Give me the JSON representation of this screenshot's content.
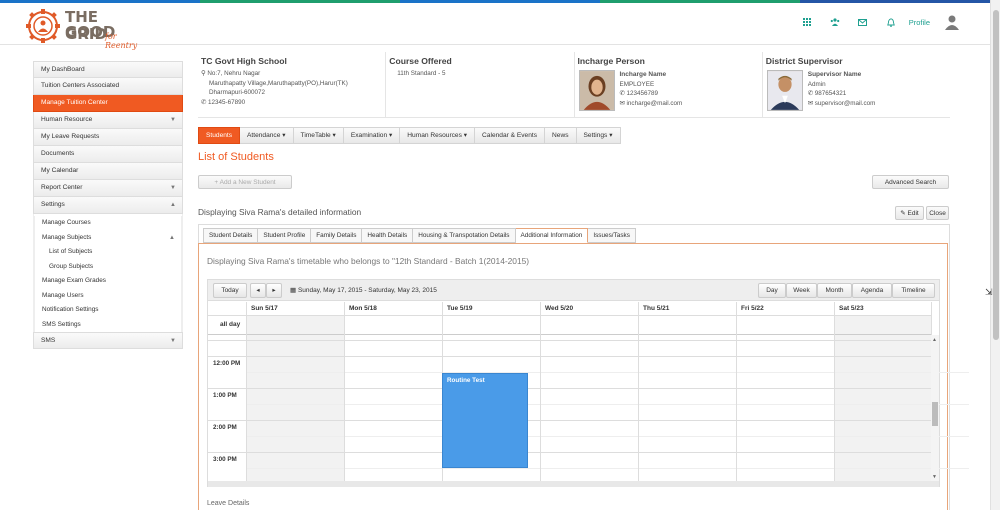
{
  "brand": {
    "line1": "THE GOOD",
    "line2": "GRID",
    "tagline": "for Reentry",
    "colors": {
      "accent": "#f05a22",
      "teal": "#1fa090"
    }
  },
  "header": {
    "icons": [
      "grid-icon",
      "users-icon",
      "mail-icon",
      "bell-icon"
    ],
    "profile_label": "Profile"
  },
  "sidebar": {
    "items": [
      {
        "label": "My DashBoard"
      },
      {
        "label": "Tuition Centers Associated"
      },
      {
        "label": "Manage Tuition Center",
        "active": true
      },
      {
        "label": "Human Resource",
        "caret": "▼"
      },
      {
        "label": "My Leave Requests"
      },
      {
        "label": "Documents"
      },
      {
        "label": "My Calendar"
      },
      {
        "label": "Report Center",
        "caret": "▼"
      },
      {
        "label": "Settings",
        "caret": "▲"
      }
    ],
    "settings_sub": [
      {
        "label": "Manage Courses"
      },
      {
        "label": "Manage Subjects",
        "caret": "▲"
      },
      {
        "label": "List of Subjects",
        "level": 2
      },
      {
        "label": "Group Subjects",
        "level": 2
      },
      {
        "label": "Manage Exam Grades"
      },
      {
        "label": "Manage Users"
      },
      {
        "label": "Notification Settings"
      },
      {
        "label": "SMS Settings"
      }
    ],
    "sms": {
      "label": "SMS",
      "caret": "▼"
    }
  },
  "school": {
    "title": "TC Govt High School",
    "address1": "No:7, Nehru Nagar",
    "address2": "Maruthapatty Village,Maruthapatty(PO),Harur(TK)",
    "address3": "Dharmapuri-600072",
    "phone": "12345-67890"
  },
  "course": {
    "title": "Course Offered",
    "value": "11th Standard - 5"
  },
  "incharge": {
    "title": "Incharge Person",
    "name": "Incharge Name",
    "role": "EMPLOYEE",
    "phone": "123456789",
    "email": "incharge@mail.com"
  },
  "supervisor": {
    "title": "District Supervisor",
    "name": "Supervisor Name",
    "role": "Admin",
    "phone": "987654321",
    "email": "supervisor@mail.com"
  },
  "nav": {
    "tabs": [
      {
        "label": "Students",
        "active": true
      },
      {
        "label": "Attendance ▾"
      },
      {
        "label": "TimeTable ▾"
      },
      {
        "label": "Examination ▾"
      },
      {
        "label": "Human Resources ▾"
      },
      {
        "label": "Calendar & Events"
      },
      {
        "label": "News"
      },
      {
        "label": "Settings ▾"
      }
    ]
  },
  "main": {
    "title": "List of Students",
    "add_label": "+ Add a New Student",
    "advanced_search": "Advanced Search",
    "detail_heading": "Displaying Siva Rama's detailed information",
    "edit_label": "✎ Edit",
    "close_label": "Close"
  },
  "detail_tabs": [
    {
      "label": "Student Details"
    },
    {
      "label": "Student Profile"
    },
    {
      "label": "Family Details"
    },
    {
      "label": "Health Details"
    },
    {
      "label": "Housing & Transpotation Details"
    },
    {
      "label": "Additional Information",
      "active": true
    },
    {
      "label": "Issues/Tasks"
    }
  ],
  "timetable": {
    "heading": "Displaying Siva Rama's timetable who belongs to \"12th Standard - Batch 1(2014-2015)",
    "today": "Today",
    "prev": "◂",
    "next": "▸",
    "range": "Sunday, May 17, 2015 - Saturday, May 23, 2015",
    "views": [
      "Day",
      "Week",
      "Month",
      "Agenda",
      "Timeline"
    ],
    "days": [
      "Sun 5/17",
      "Mon 5/18",
      "Tue 5/19",
      "Wed 5/20",
      "Thu 5/21",
      "Fri 5/22",
      "Sat 5/23"
    ],
    "allday_label": "all day",
    "times": [
      "12:00 PM",
      "1:00 PM",
      "2:00 PM",
      "3:00 PM"
    ],
    "event": {
      "title": "Routine Test",
      "day": "Tue 5/19",
      "start": "12:30 PM",
      "end": "3:30 PM"
    }
  },
  "footer": {
    "leave_details": "Leave Details"
  }
}
